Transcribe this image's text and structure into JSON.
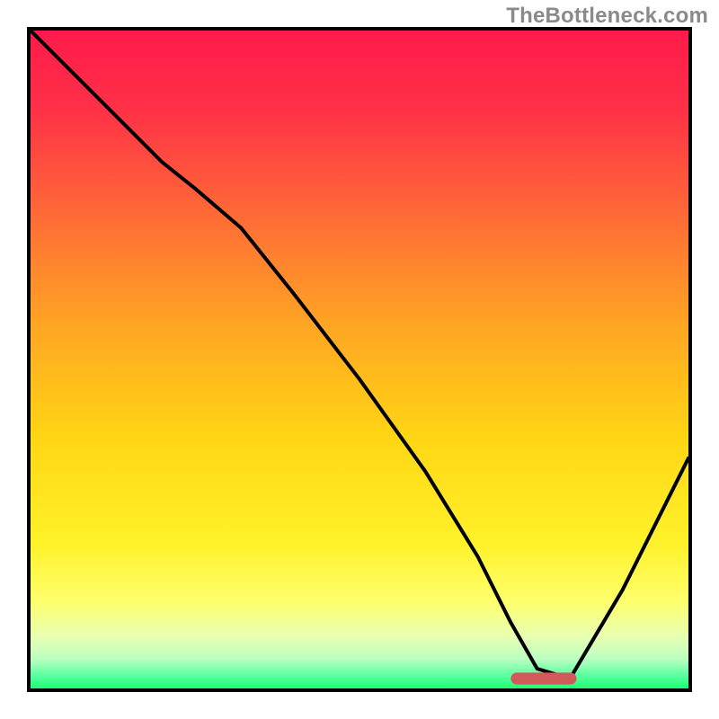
{
  "attribution": "TheBottleneck.com",
  "colors": {
    "border": "#000000",
    "attribution_text": "#8a8a8a",
    "gradient_stops": [
      {
        "offset": 0.0,
        "color": "#ff1a4b"
      },
      {
        "offset": 0.12,
        "color": "#ff3147"
      },
      {
        "offset": 0.28,
        "color": "#ff6a36"
      },
      {
        "offset": 0.45,
        "color": "#ffa623"
      },
      {
        "offset": 0.62,
        "color": "#ffd614"
      },
      {
        "offset": 0.78,
        "color": "#fff22a"
      },
      {
        "offset": 0.87,
        "color": "#fdff6e"
      },
      {
        "offset": 0.92,
        "color": "#e9ffb1"
      },
      {
        "offset": 0.955,
        "color": "#bcffc0"
      },
      {
        "offset": 0.98,
        "color": "#5cffa0"
      },
      {
        "offset": 1.0,
        "color": "#1aff76"
      }
    ],
    "curve": "#000000",
    "marker_fill": "#d05a5a",
    "marker_stroke": "#d05a5a"
  },
  "chart_data": {
    "type": "line",
    "title": "",
    "xlabel": "",
    "ylabel": "",
    "xlim": [
      0,
      100
    ],
    "ylim": [
      0,
      100
    ],
    "series": [
      {
        "name": "curve",
        "x": [
          0,
          10,
          20,
          25,
          32,
          40,
          50,
          60,
          68,
          73,
          77,
          82,
          90,
          100
        ],
        "y": [
          100,
          90,
          80,
          76,
          70,
          60,
          47,
          33,
          20,
          10,
          3,
          1.5,
          15,
          35
        ]
      }
    ],
    "marker": {
      "name": "optimal-range",
      "x_start": 73,
      "x_end": 83,
      "y": 1.5
    }
  }
}
